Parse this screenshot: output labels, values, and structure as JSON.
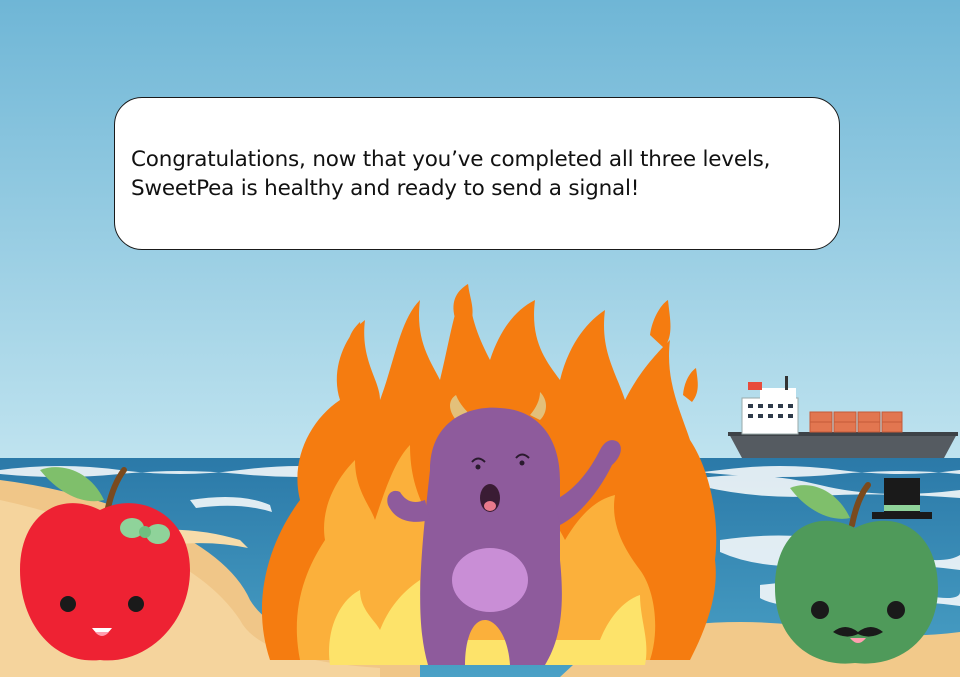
{
  "dialog": {
    "message": "Congratulations, now that you’ve completed all three levels,\nSweetPea is healthy and ready to send a signal!"
  },
  "scene": {
    "sky_color": "#79bcd9",
    "ocean_color": "#2f7fae",
    "sand_color": "#f2c98a",
    "fire_colors": [
      "#f57c10",
      "#fbb03b",
      "#fde36a"
    ],
    "monster_color": "#8e5b9c"
  },
  "characters": [
    {
      "name": "red-apple",
      "icon": "apple-with-bow",
      "color": "#ee2233"
    },
    {
      "name": "purple-monster",
      "icon": "horned-monster",
      "color": "#8e5b9c"
    },
    {
      "name": "green-apple",
      "icon": "apple-with-top-hat",
      "color": "#4f9a5a"
    }
  ]
}
